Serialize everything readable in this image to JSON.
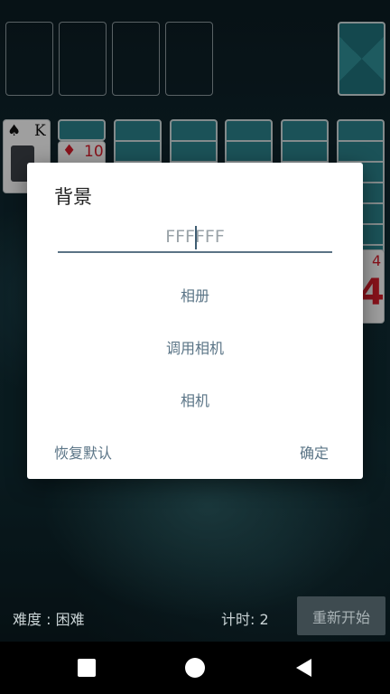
{
  "dialog": {
    "title": "背景",
    "color_value": "FFFFFF",
    "options": [
      "相册",
      "调用相机",
      "相机"
    ],
    "reset_label": "恢复默认",
    "confirm_label": "确定"
  },
  "status": {
    "difficulty": "难度 : 困难",
    "timer": "计时: 2",
    "restart_label": "重新开始"
  },
  "cards": {
    "king_rank": "K",
    "king_suit": "♠",
    "ten_rank": "10",
    "ten_suit": "♦",
    "four_rank": "4"
  },
  "colors": {
    "card_back": "#2a7f88",
    "dialog_accent": "#5a7486",
    "red_suit": "#d21d2a"
  }
}
